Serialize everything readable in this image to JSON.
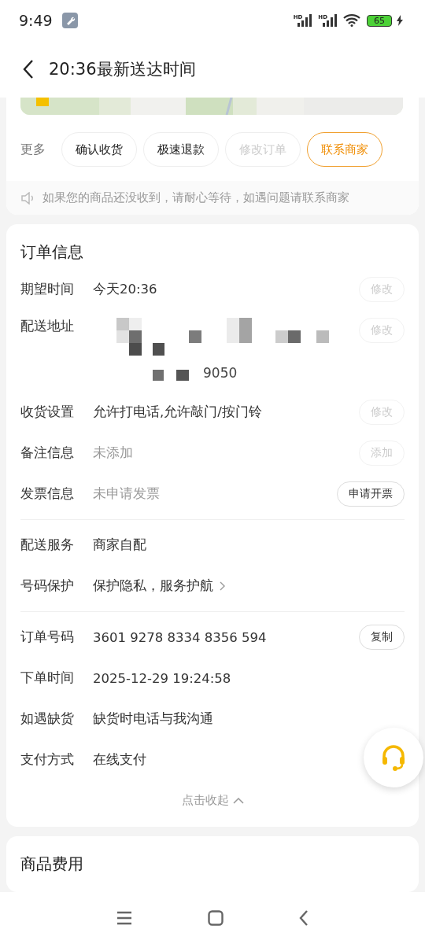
{
  "status_bar": {
    "time": "9:49",
    "network_labels": [
      "HD",
      "HD"
    ],
    "battery": "65"
  },
  "header": {
    "title": "20:36最新送达时间"
  },
  "actions": {
    "label": "更多",
    "buttons": [
      {
        "label": "确认收货",
        "disabled": false,
        "highlighted": false
      },
      {
        "label": "极速退款",
        "disabled": false,
        "highlighted": false
      },
      {
        "label": "修改订单",
        "disabled": true,
        "highlighted": false
      },
      {
        "label": "联系商家",
        "disabled": false,
        "highlighted": true
      }
    ]
  },
  "notice": "如果您的商品还没收到，请耐心等待，如遇问题请联系商家",
  "order_info": {
    "title": "订单信息",
    "groups": [
      [
        {
          "kind": "text",
          "label": "期望时间",
          "value": "今天20:36",
          "action": {
            "label": "修改",
            "disabled": true
          }
        },
        {
          "kind": "redacted",
          "label": "配送地址",
          "value": "9050",
          "action": {
            "label": "修改",
            "disabled": true
          }
        },
        {
          "kind": "text",
          "label": "收货设置",
          "value": "允许打电话,允许敲门/按门铃",
          "action": {
            "label": "修改",
            "disabled": true
          }
        },
        {
          "kind": "text",
          "label": "备注信息",
          "value": "未添加",
          "muted": true,
          "action": {
            "label": "添加",
            "disabled": true
          }
        },
        {
          "kind": "text",
          "label": "发票信息",
          "value": "未申请发票",
          "muted": true,
          "action": {
            "label": "申请开票",
            "disabled": false
          }
        }
      ],
      [
        {
          "kind": "text",
          "label": "配送服务",
          "value": "商家自配"
        },
        {
          "kind": "text",
          "label": "号码保护",
          "value": "保护隐私，服务护航",
          "link": true
        }
      ],
      [
        {
          "kind": "text",
          "label": "订单号码",
          "value": "3601 9278 8334 8356 594",
          "action": {
            "label": "复制",
            "disabled": false
          }
        },
        {
          "kind": "text",
          "label": "下单时间",
          "value": "2025-12-29 19:24:58"
        },
        {
          "kind": "text",
          "label": "如遇缺货",
          "value": "缺货时电话与我沟通"
        },
        {
          "kind": "text",
          "label": "支付方式",
          "value": "在线支付"
        }
      ]
    ],
    "collapse": "点击收起"
  },
  "fees": {
    "title": "商品费用"
  }
}
